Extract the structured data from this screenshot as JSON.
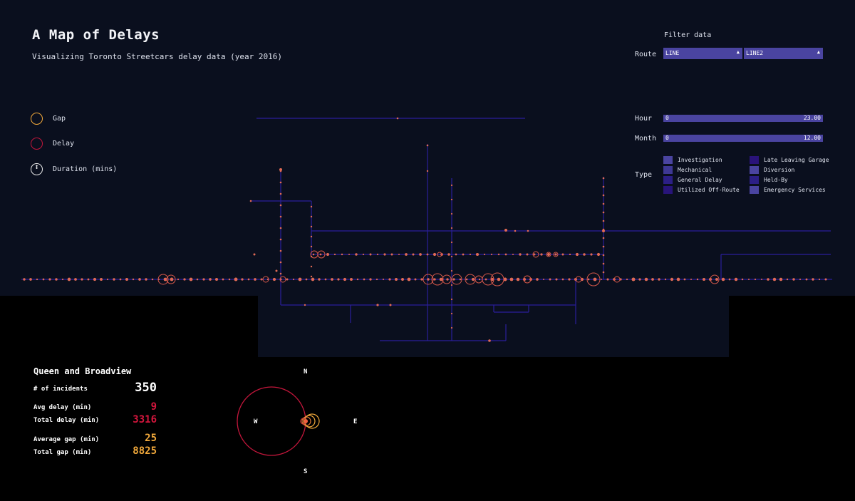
{
  "header": {
    "title": "A Map of Delays",
    "subtitle": "Visualizing Toronto Streetcars delay data (year 2016)"
  },
  "legend": {
    "gap": "Gap",
    "delay": "Delay",
    "duration": "Duration (mins)"
  },
  "filters": {
    "title": "Filter data",
    "route_label": "Route",
    "route_select_1": "LINE",
    "route_select_2": "LINE2",
    "hour_label": "Hour",
    "hour_min": "0",
    "hour_max": "23.00",
    "month_label": "Month",
    "month_min": "0",
    "month_max": "12.00",
    "type_label": "Type",
    "types": [
      "Investigation",
      "Mechanical",
      "General Delay",
      "Utilized Off-Route",
      "Late Leaving Garage",
      "Diversion",
      "Held-By",
      "Emergency Services"
    ]
  },
  "colors": {
    "gap": "#f2a93b",
    "delay": "#c2163b",
    "track": "#2a1e9a",
    "incident": "#e06a55",
    "panel": "#0a0f1e",
    "control": "#4a44a0"
  },
  "info": {
    "location": "Queen and Broadview",
    "incidents_label": "# of incidents",
    "incidents": "350",
    "avg_delay_label": "Avg delay (min)",
    "avg_delay": "9",
    "total_delay_label": "Total delay (min)",
    "total_delay": "3316",
    "avg_gap_label": "Average gap (min)",
    "avg_gap": "25",
    "total_gap_label": "Total gap (min)",
    "total_gap": "8825"
  },
  "compass": {
    "n": "N",
    "s": "S",
    "e": "E",
    "w": "W"
  }
}
